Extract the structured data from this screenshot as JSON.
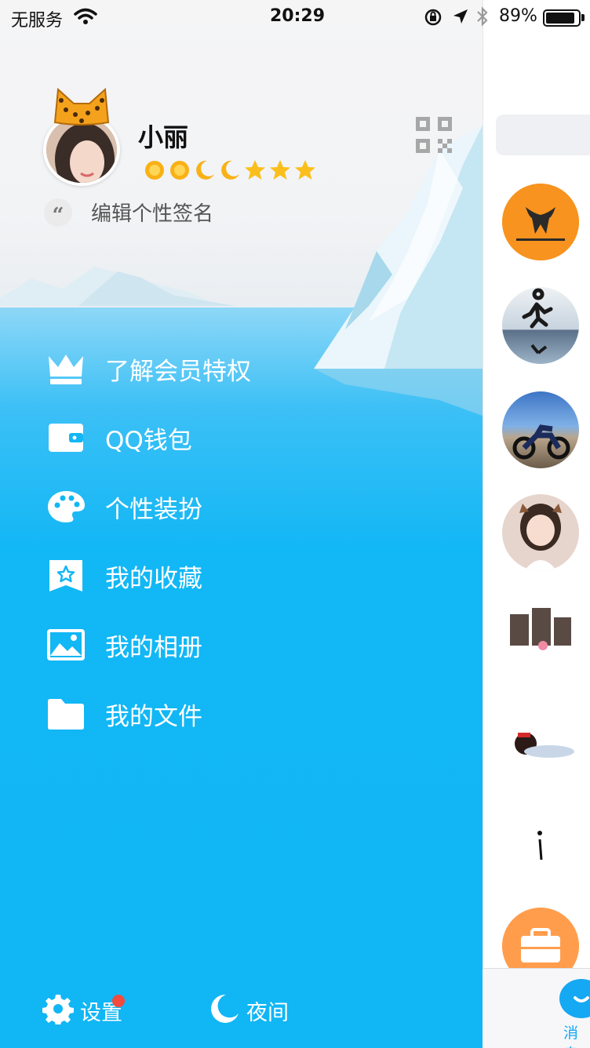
{
  "status_bar": {
    "carrier": "无服务",
    "time": "20:29",
    "battery_percent": "89%",
    "battery_level": 0.89
  },
  "profile": {
    "name": "小丽",
    "signature": "编辑个性签名",
    "quote_glyph": "“",
    "level_icons": [
      "sun-icon",
      "sun-icon",
      "moon-icon",
      "moon-icon",
      "star-icon",
      "star-icon",
      "star-icon"
    ]
  },
  "menu": {
    "items": [
      {
        "label": "了解会员特权",
        "icon": "crown-icon"
      },
      {
        "label": "QQ钱包",
        "icon": "wallet-icon"
      },
      {
        "label": "个性装扮",
        "icon": "palette-icon"
      },
      {
        "label": "我的收藏",
        "icon": "bookmark-star-icon"
      },
      {
        "label": "我的相册",
        "icon": "photo-icon"
      },
      {
        "label": "我的文件",
        "icon": "folder-icon"
      }
    ]
  },
  "bottom": {
    "settings_label": "设置",
    "night_label": "夜间"
  },
  "peek": {
    "tab_label": "消息"
  },
  "colors": {
    "drawer_blue": "#12b7f5",
    "notification_red": "#f24a3d",
    "tab_blue": "#15a8f3"
  }
}
